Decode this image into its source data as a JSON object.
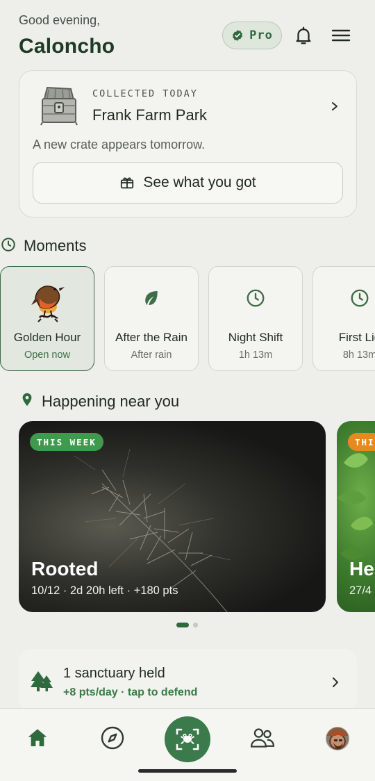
{
  "header": {
    "greeting": "Good evening,",
    "username": "Caloncho",
    "pro_label": "Pro",
    "icons": [
      "verified-badge-icon",
      "bell-icon",
      "menu-icon"
    ]
  },
  "crate": {
    "kicker": "COLLECTED TODAY",
    "title": "Frank Farm Park",
    "subtitle": "A new crate appears tomorrow.",
    "button_label": "See what you got",
    "icons": [
      "treasure-chest-icon",
      "gift-icon",
      "chevron-right-icon"
    ]
  },
  "moments": {
    "title": "Moments",
    "items": [
      {
        "name": "Golden Hour",
        "status": "Open now",
        "icon": "robin-bird-icon",
        "active": true
      },
      {
        "name": "After the Rain",
        "status": "After rain",
        "icon": "leaf-icon",
        "active": false
      },
      {
        "name": "Night Shift",
        "status": "1h 13m",
        "icon": "clock-icon",
        "active": false
      },
      {
        "name": "First Lig",
        "status": "8h 13m",
        "icon": "clock-icon",
        "active": false
      }
    ]
  },
  "near": {
    "title": "Happening near you",
    "events": [
      {
        "badge": "THIS WEEK",
        "title": "Rooted",
        "meta": "10/12 · 2d 20h left · +180 pts"
      },
      {
        "badge": "THIS",
        "title": "Her",
        "meta": "27/4"
      }
    ],
    "page_indicator": {
      "count": 2,
      "active": 0
    }
  },
  "sanctuary": {
    "title": "1 sanctuary held",
    "subtitle": "+8 pts/day · tap to defend"
  },
  "nav": {
    "items": [
      "home-icon",
      "compass-icon",
      "frog-scan-icon",
      "people-icon",
      "profile-avatar"
    ]
  },
  "colors": {
    "accent": "#3b7a4a",
    "badge_green": "#3f9a4e",
    "badge_orange": "#e58a1f",
    "background": "#eeeeea"
  }
}
